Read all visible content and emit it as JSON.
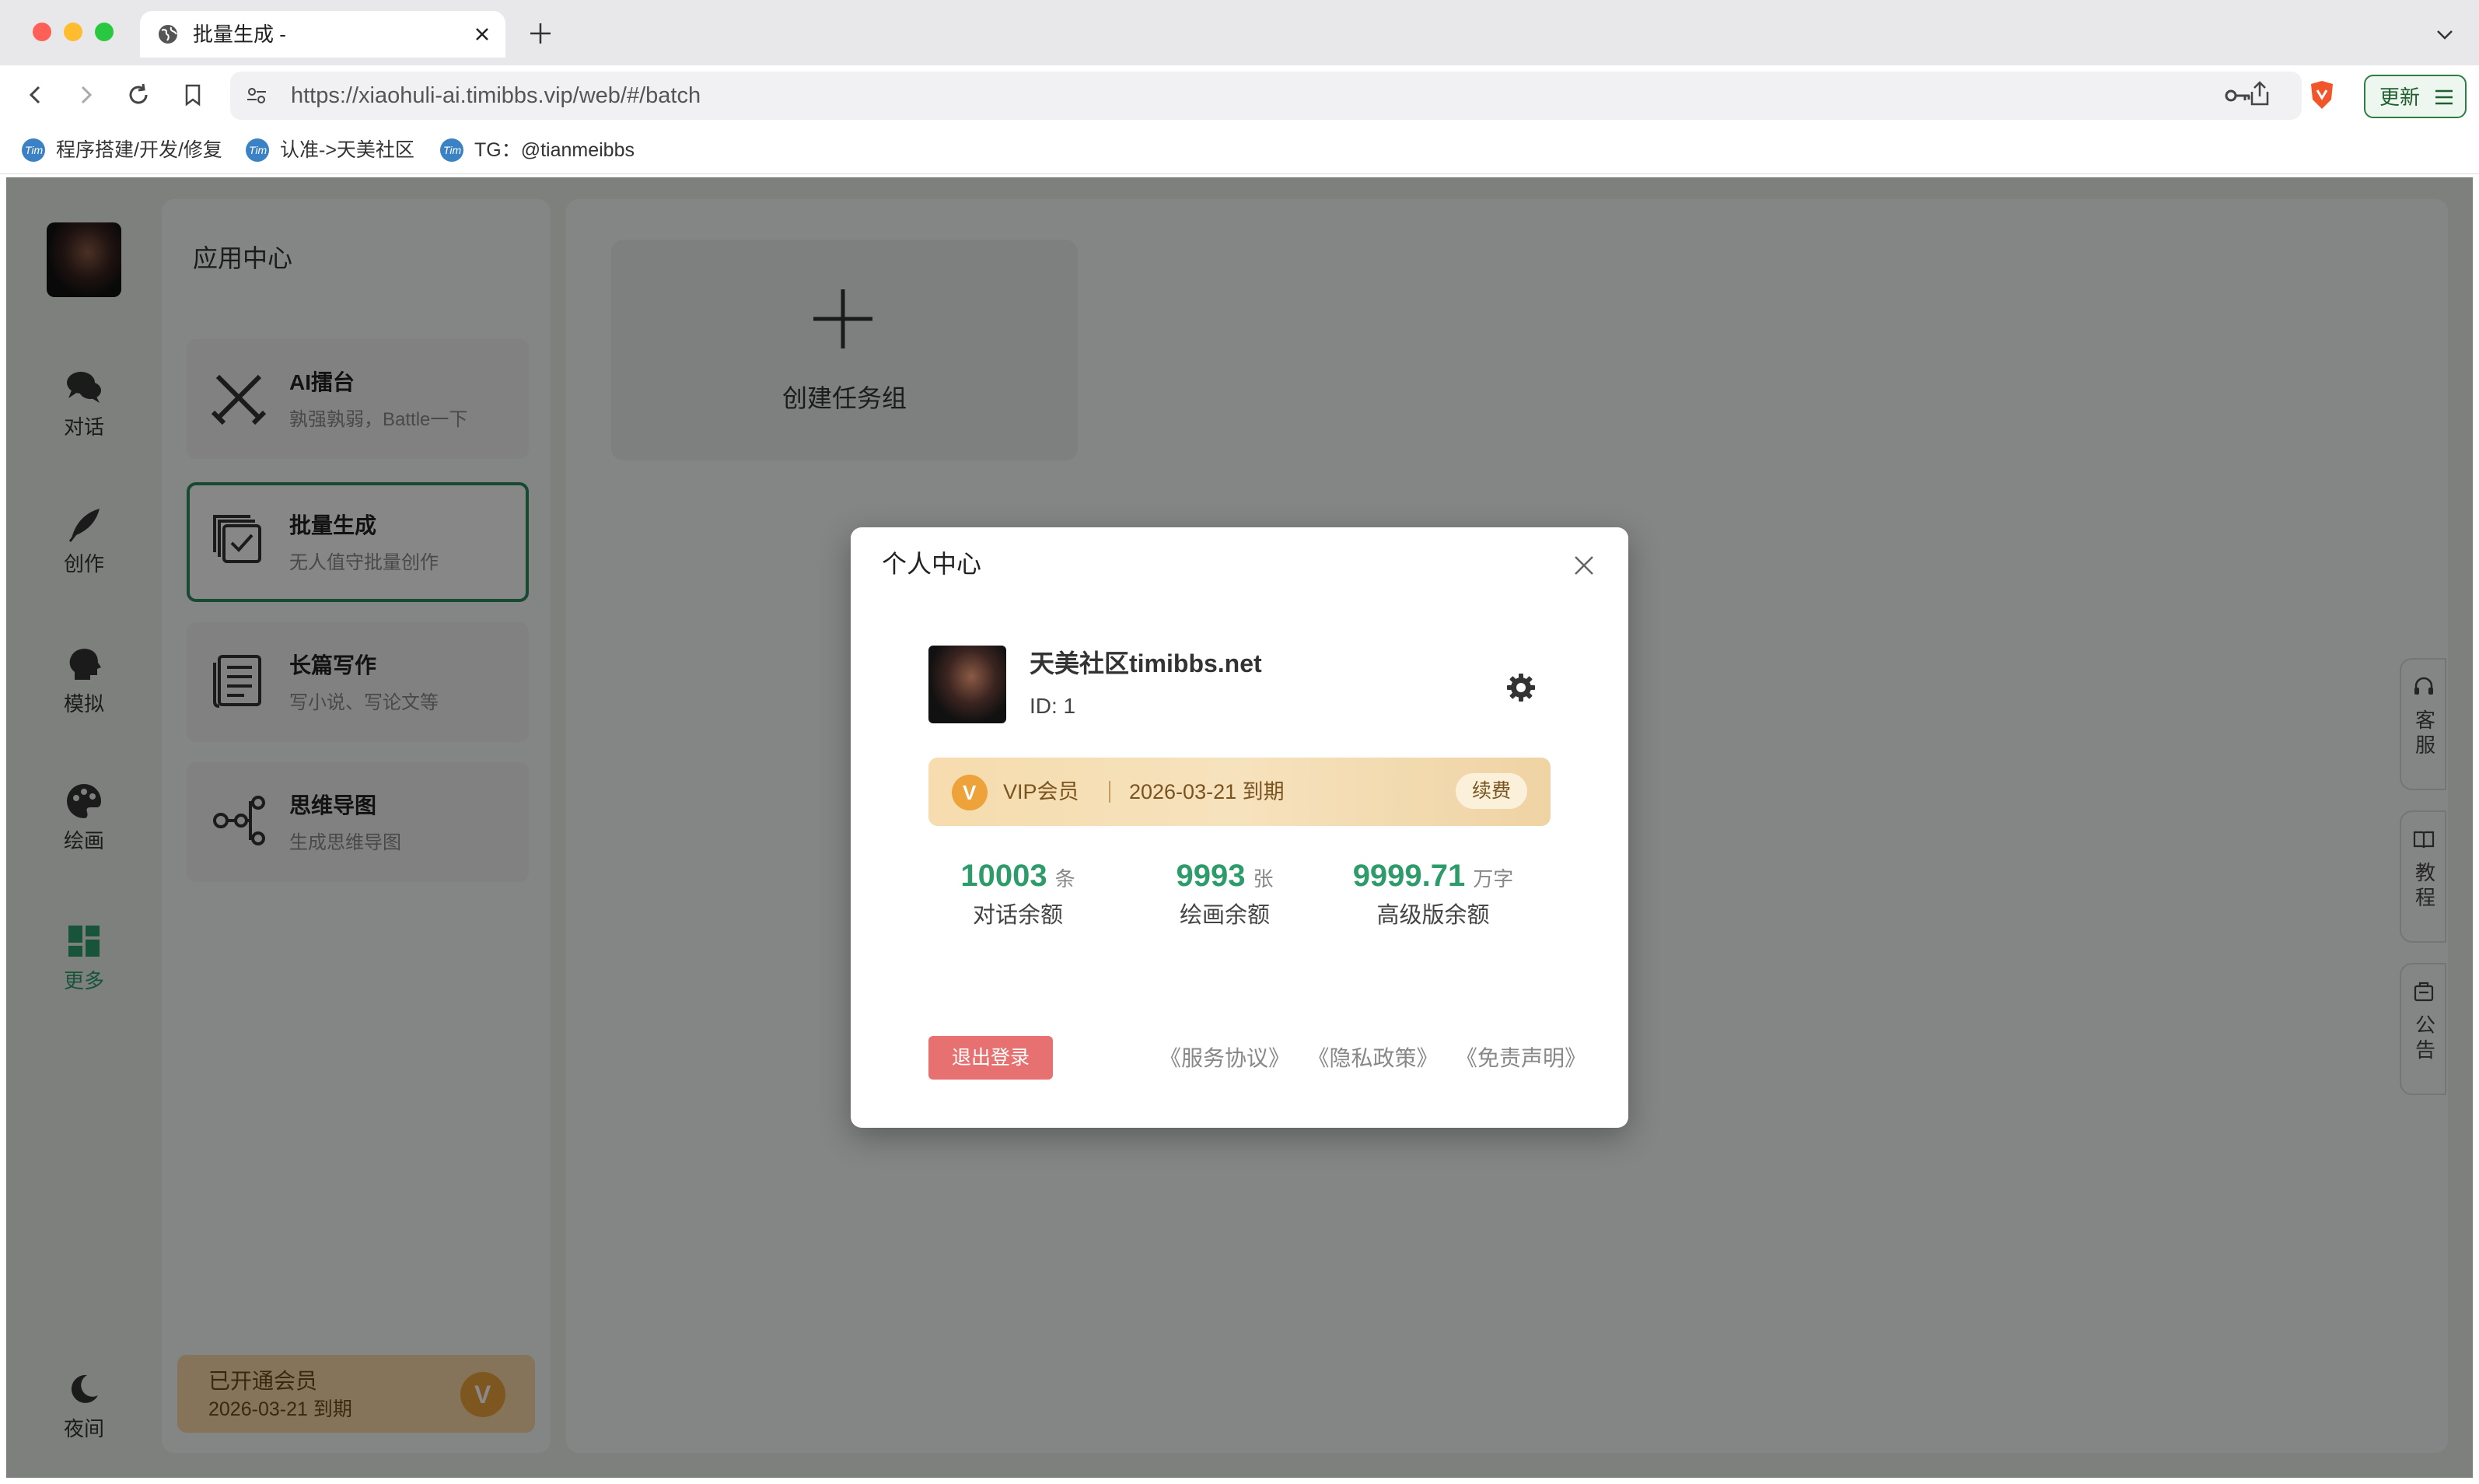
{
  "browser": {
    "tab_title": "批量生成 -",
    "url": "https://xiaohuli-ai.timibbs.vip/web/#/batch",
    "update_label": "更新",
    "bookmarks": [
      {
        "label": "程序搭建/开发/修复",
        "icon_text": "Tim"
      },
      {
        "label": "认准->天美社区",
        "icon_text": "Tim"
      },
      {
        "label": "TG：@tianmeibbs",
        "icon_text": "Tim"
      }
    ]
  },
  "leftnav": {
    "items": [
      {
        "label": "对话",
        "icon": "chat-bubbles-icon"
      },
      {
        "label": "创作",
        "icon": "feather-icon"
      },
      {
        "label": "模拟",
        "icon": "head-icon"
      },
      {
        "label": "绘画",
        "icon": "palette-icon"
      },
      {
        "label": "更多",
        "icon": "grid-icon"
      }
    ],
    "night_label": "夜间"
  },
  "app_center": {
    "title": "应用中心",
    "apps": [
      {
        "title": "AI擂台",
        "desc": "孰强孰弱，Battle一下",
        "icon": "crossed-swords-icon"
      },
      {
        "title": "批量生成",
        "desc": "无人值守批量创作",
        "icon": "batch-check-icon"
      },
      {
        "title": "长篇写作",
        "desc": "写小说、写论文等",
        "icon": "document-icon"
      },
      {
        "title": "思维导图",
        "desc": "生成思维导图",
        "icon": "mindmap-icon"
      }
    ],
    "member_banner": {
      "title": "已开通会员",
      "date": "2026-03-21 到期",
      "badge": "V"
    }
  },
  "main": {
    "create_label": "创建任务组"
  },
  "side_tabs": [
    {
      "label": "客服",
      "icon": "headset-icon"
    },
    {
      "label": "教程",
      "icon": "book-icon"
    },
    {
      "label": "公告",
      "icon": "notice-icon"
    }
  ],
  "modal": {
    "title": "个人中心",
    "user_name": "天美社区timibbs.net",
    "user_id": "ID: 1",
    "vip": {
      "badge": "V",
      "label": "VIP会员",
      "expiry": "2026-03-21 到期",
      "renew_label": "续费"
    },
    "stats": [
      {
        "value": "10003",
        "unit": "条",
        "label": "对话余额"
      },
      {
        "value": "9993",
        "unit": "张",
        "label": "绘画余额"
      },
      {
        "value": "9999.71",
        "unit": "万字",
        "label": "高级版余额"
      }
    ],
    "logout_label": "退出登录",
    "links": [
      "《服务协议》",
      "《隐私政策》",
      "《免责声明》"
    ]
  },
  "colors": {
    "accent": "#2e9c6a",
    "logout": "#e67170",
    "vip_gold": "#eda23a"
  }
}
